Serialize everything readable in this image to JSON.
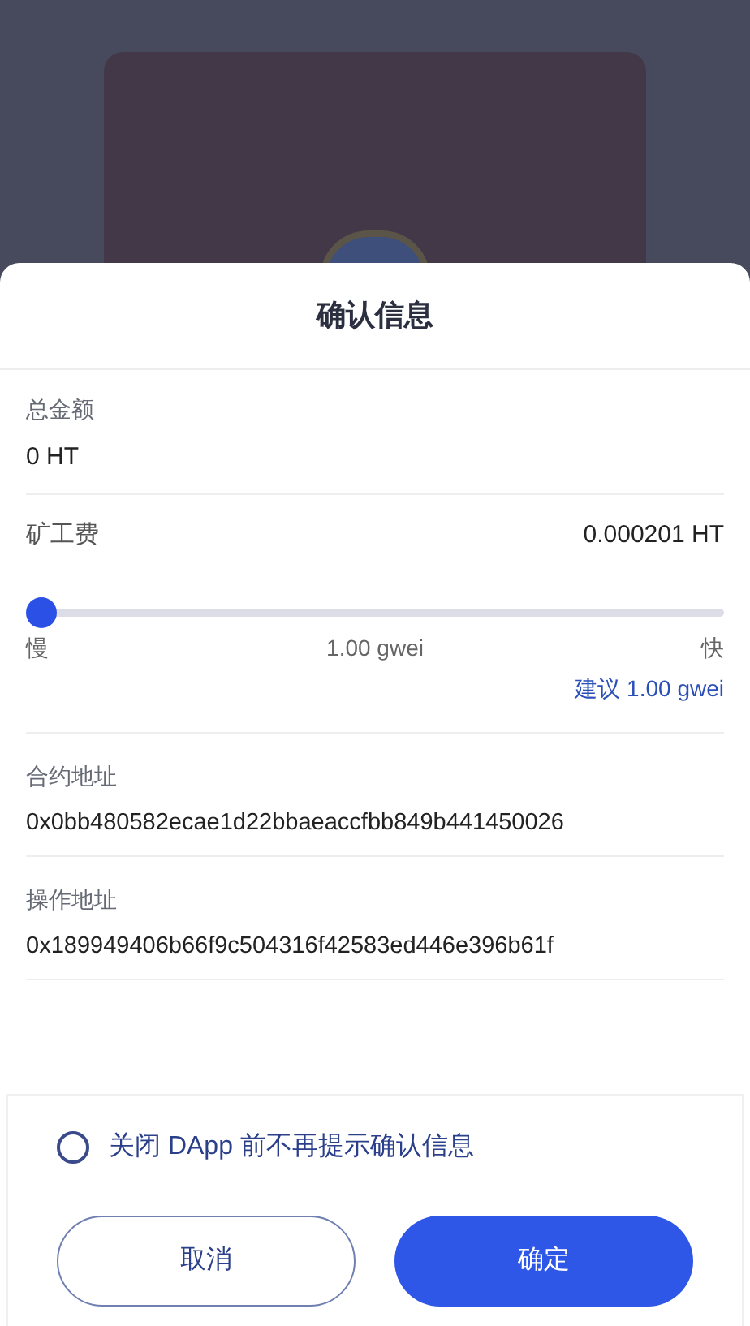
{
  "sheet": {
    "title": "确认信息"
  },
  "total": {
    "label": "总金额",
    "value": "0 HT"
  },
  "fee": {
    "label": "矿工费",
    "value": "0.000201 HT",
    "level": 0,
    "slow": "慢",
    "reading": "1.00 gwei",
    "fast": "快",
    "suggestion": "建议 1.00 gwei"
  },
  "addresses": [
    {
      "label": "合约地址",
      "value": "0x0bb480582ecae1d22bbaeaccfbb849b441450026"
    },
    {
      "label": "操作地址",
      "value": "0x189949406b66f9c504316f42583ed446e396b61f"
    }
  ],
  "reminder": {
    "label": "关闭 DApp 前不再提示确认信息",
    "checked": false
  },
  "buttons": {
    "cancel": "取消",
    "confirm": "确定"
  }
}
